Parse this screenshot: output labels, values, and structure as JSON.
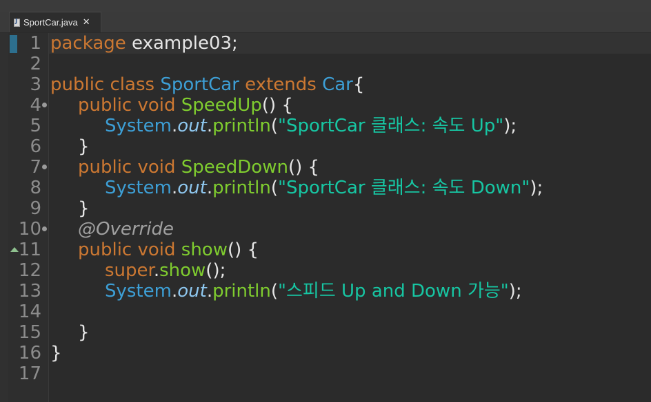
{
  "tab": {
    "filename": "SportCar.java",
    "close_glyph": "✕"
  },
  "line_numbers": [
    "1",
    "2",
    "3",
    "4",
    "5",
    "6",
    "7",
    "8",
    "9",
    "10",
    "11",
    "12",
    "13",
    "14",
    "15",
    "16",
    "17"
  ],
  "code": {
    "l1_kw": "package",
    "l1_rest": " example03;",
    "l3_kw1": "public class ",
    "l3_type": "SportCar",
    "l3_kw2": " extends ",
    "l3_type2": "Car",
    "l3_brace": "{",
    "l4_kw": "public void ",
    "l4_method": "SpeedUp",
    "l4_rest": "() {",
    "l5_type": "System",
    "l5_dot": ".",
    "l5_field": "out",
    "l5_dot2": ".",
    "l5_method": "println",
    "l5_open": "(",
    "l5_str": "\"SportCar 클래스: 속도 Up\"",
    "l5_close": ");",
    "l6": "}",
    "l7_kw": "public void ",
    "l7_method": "SpeedDown",
    "l7_rest": "() {",
    "l8_type": "System",
    "l8_dot": ".",
    "l8_field": "out",
    "l8_dot2": ".",
    "l8_method": "println",
    "l8_open": "(",
    "l8_str": "\"SportCar 클래스: 속도 Down\"",
    "l8_close": ");",
    "l9": "}",
    "l10_anno": "@Override",
    "l11_kw": "public void ",
    "l11_method": "show",
    "l11_rest": "() {",
    "l12_kw": "super",
    "l12_dot": ".",
    "l12_method": "show",
    "l12_rest": "();",
    "l13_type": "System",
    "l13_dot": ".",
    "l13_field": "out",
    "l13_dot2": ".",
    "l13_method": "println",
    "l13_open": "(",
    "l13_str": "\"스피드 Up and Down 가능\"",
    "l13_close": ");",
    "l15": "}",
    "l16": "}"
  },
  "colors": {
    "keyword": "#cc7832",
    "type": "#3d9fd6",
    "method": "#7fcc2f",
    "string": "#17c6a3",
    "field": "#8fc8f0",
    "annotation": "#a0a0a0"
  }
}
